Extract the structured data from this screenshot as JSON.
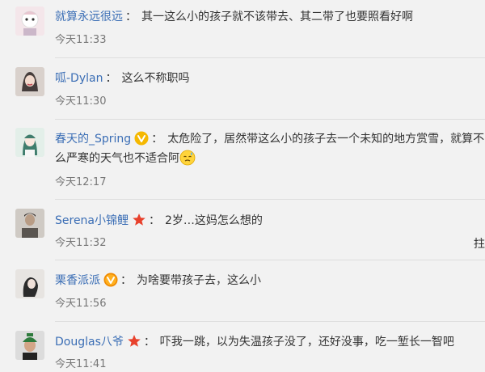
{
  "comments": [
    {
      "username": "就算永远很远",
      "separator": "：",
      "text": "其一这么小的孩子就不该带去、其二带了也要照看好啊",
      "time": "今天11:33",
      "avatar_icon": "girl-cartoon-avatar-icon"
    },
    {
      "username": "呱-Dylan",
      "separator": "：",
      "text": "这么不称职吗",
      "time": "今天11:30",
      "avatar_icon": "woman-photo-avatar-icon"
    },
    {
      "username": "春天的_Spring",
      "badge": "gold-v-badge",
      "separator": "：",
      "text": "太危险了，居然带这么小的孩子去一个未知的地方赏雪，就算不",
      "text2": "么严寒的天气也不适合阿",
      "emoji": "sweat-face-emoji",
      "time": "今天12:17",
      "avatar_icon": "anime-girl-avatar-icon"
    },
    {
      "username": "Serena小锦鲤",
      "badge": "red-star-badge",
      "separator": "：",
      "text": "2岁…这妈怎么想的",
      "time": "今天11:32",
      "edge_glyph": "拄",
      "avatar_icon": "person-photo-avatar-icon"
    },
    {
      "username": "栗香派派",
      "badge": "orange-v-badge",
      "separator": "：",
      "text": "为啥要带孩子去，这么小",
      "time": "今天11:56",
      "avatar_icon": "woman-profile-avatar-icon"
    },
    {
      "username": "Douglas八爷",
      "badge": "red-star-badge",
      "separator": "：",
      "text": "吓我一跳，以为失温孩子没了，还好没事，吃一堑长一智吧",
      "time": "今天11:41",
      "avatar_icon": "man-cap-avatar-icon"
    }
  ],
  "colors": {
    "username": "#3b6eb5",
    "time": "#777777",
    "background": "#f2f2f2",
    "divider": "#dedede"
  }
}
